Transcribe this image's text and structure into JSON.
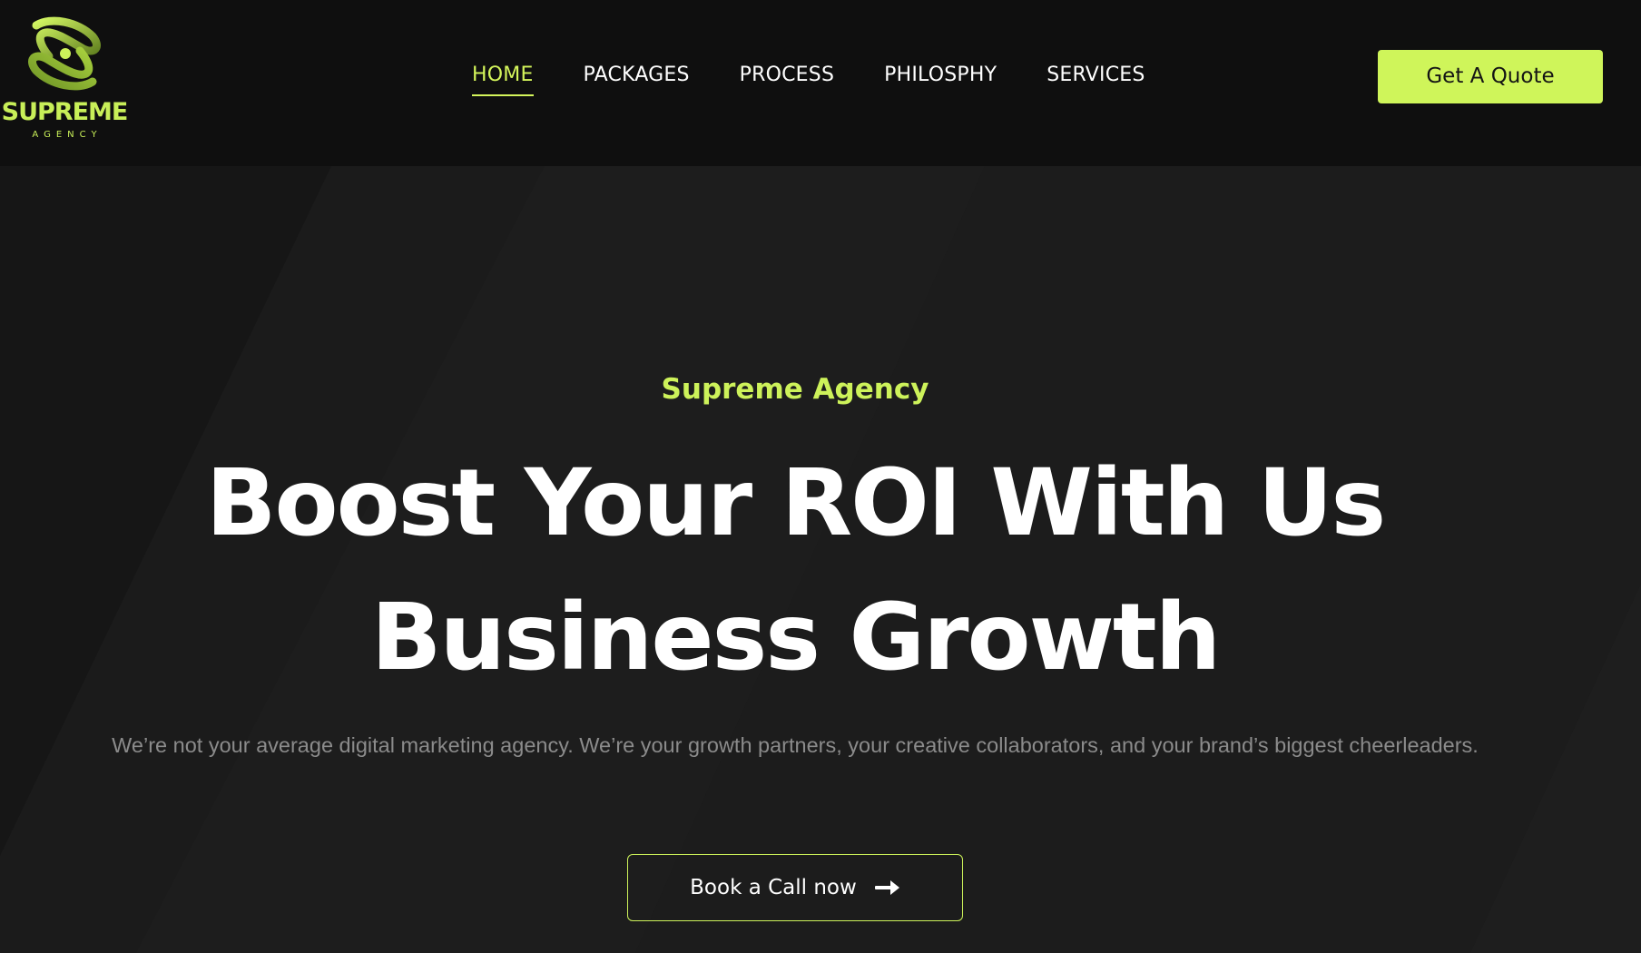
{
  "header": {
    "logo": {
      "name": "SUPREME",
      "tagline": "AGENCY",
      "icon": "orbit-knot-logo-icon"
    },
    "nav": [
      {
        "label": "HOME",
        "active": true
      },
      {
        "label": "PACKAGES",
        "active": false
      },
      {
        "label": "PROCESS",
        "active": false
      },
      {
        "label": "PHILOSPHY",
        "active": false
      },
      {
        "label": "SERVICES",
        "active": false
      }
    ],
    "quote_button": "Get A Quote"
  },
  "hero": {
    "eyebrow": "Supreme Agency",
    "headline_line1": "Boost Your ROI With Us",
    "headline_line2": "Business Growth",
    "lede": "We’re not your average digital marketing agency. We’re your growth partners, your creative collaborators, and your brand’s biggest cheerleaders.",
    "cta_label": "Book a Call now",
    "cta_icon": "arrow-right-icon"
  },
  "colors": {
    "accent": "#cff55a",
    "header_bg": "#0f0f0f",
    "hero_bg": "#1b1b1b",
    "text": "#ffffff",
    "muted_text": "#8b8b8b"
  }
}
